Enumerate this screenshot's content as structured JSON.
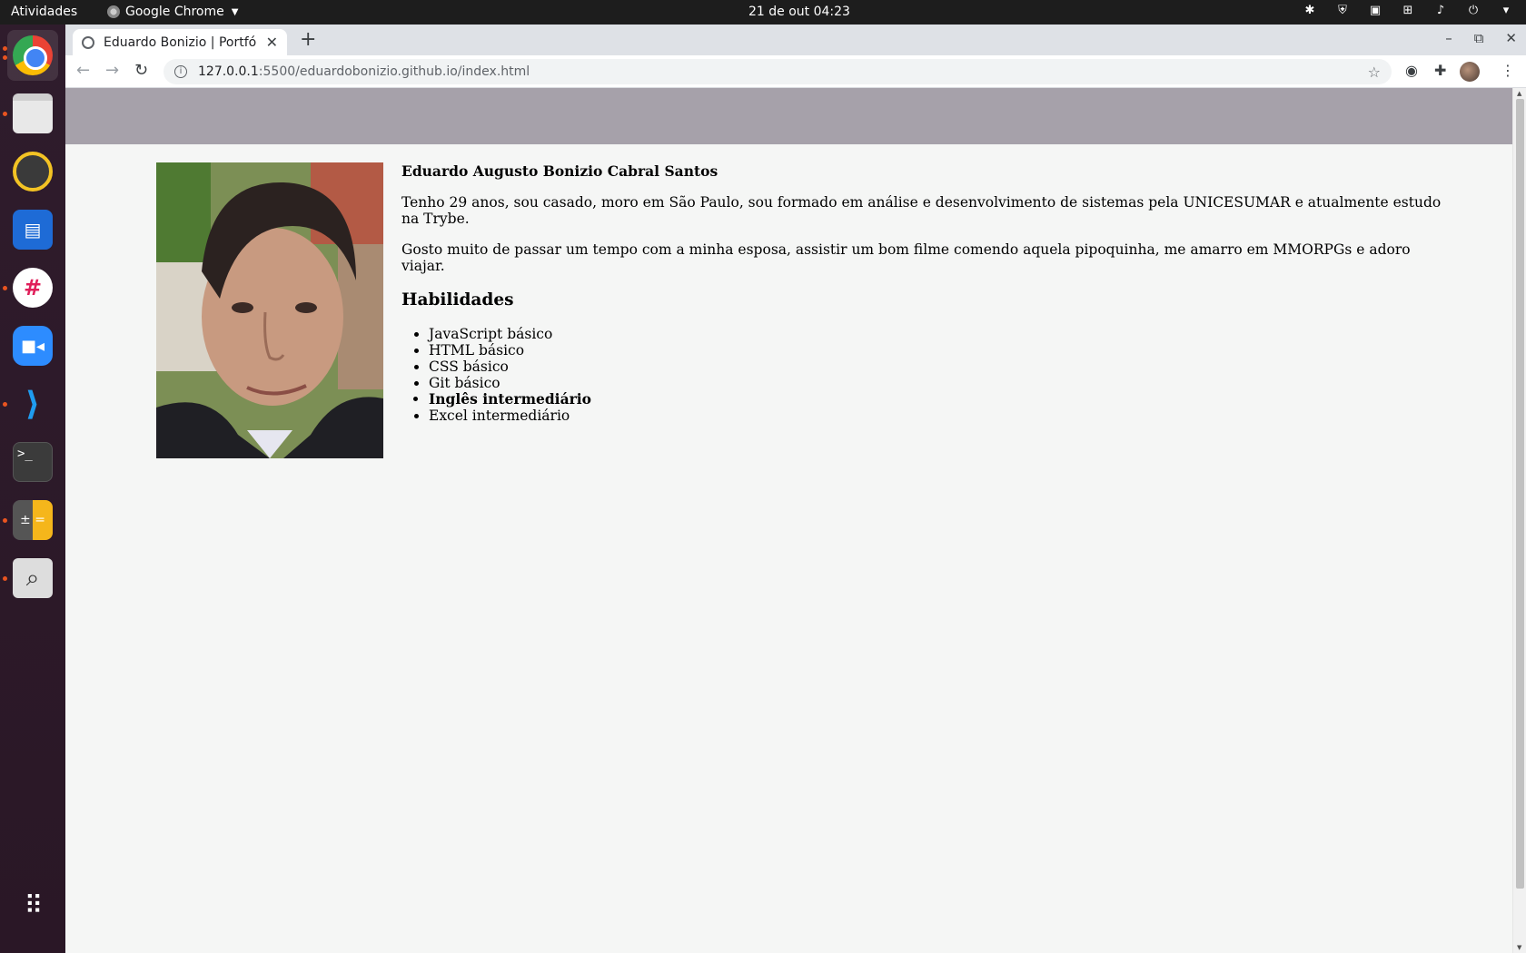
{
  "topbar": {
    "activities": "Atividades",
    "app_name": "Google Chrome",
    "clock": "21 de out  04:23"
  },
  "dock": {
    "items": [
      "chrome",
      "files",
      "rhythmbox",
      "writer",
      "slack",
      "zoom",
      "vscode",
      "terminal",
      "calculator",
      "search",
      "apps"
    ]
  },
  "browser": {
    "tab_title": "Eduardo Bonizio | Portfólio",
    "url_host": "127.0.0.1",
    "url_path": ":5500/eduardobonizio.github.io/index.html"
  },
  "page": {
    "header_color": "#a6a1aa",
    "name": "Eduardo Augusto Bonizio Cabral Santos",
    "bio_1": "Tenho 29 anos, sou casado, moro em São Paulo, sou formado em análise e desenvolvimento de sistemas pela UNICESUMAR e atualmente estudo na Trybe.",
    "bio_2": "Gosto muito de passar um tempo com a minha esposa, assistir um bom filme comendo aquela pipoquinha, me amarro em MMORPGs e adoro viajar.",
    "skills_heading": "Habilidades",
    "skills": [
      {
        "label": "JavaScript básico",
        "bold": false
      },
      {
        "label": "HTML básico",
        "bold": false
      },
      {
        "label": "CSS básico",
        "bold": false
      },
      {
        "label": "Git básico",
        "bold": false
      },
      {
        "label": "Inglês intermediário",
        "bold": true
      },
      {
        "label": "Excel intermediário",
        "bold": false
      }
    ]
  }
}
